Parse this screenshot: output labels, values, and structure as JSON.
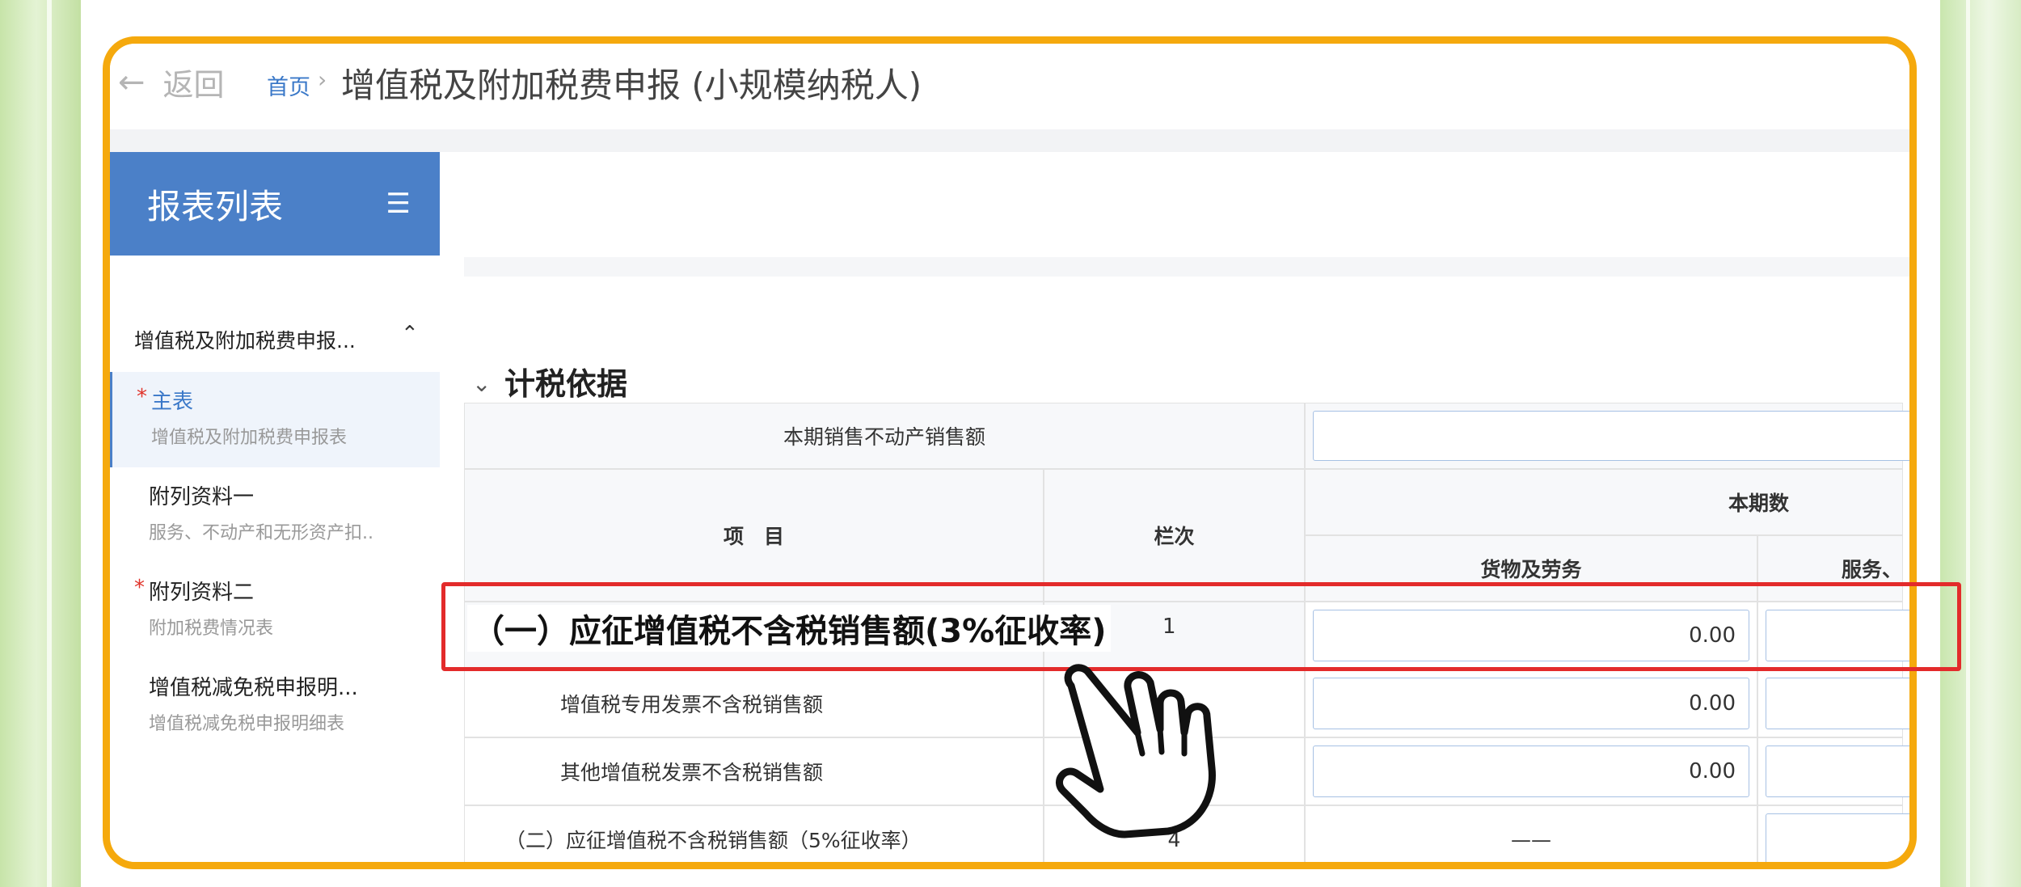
{
  "nav": {
    "back_label": "返回",
    "home_label": "首页",
    "separator": "›",
    "page_title": "增值税及附加税费申报 (小规模纳税人)"
  },
  "sidebar": {
    "header": "报表列表",
    "group_title": "增值税及附加税费申报...",
    "items": [
      {
        "title": "主表",
        "subtitle": "增值税及附加税费申报表",
        "required": "*"
      },
      {
        "title": "附列资料一",
        "subtitle": "服务、不动产和无形资产扣..",
        "required": ""
      },
      {
        "title": "附列资料二",
        "subtitle": "附加税费情况表",
        "required": "*"
      },
      {
        "title": "增值税减免税申报明...",
        "subtitle": "增值税减免税申报明细表",
        "required": ""
      }
    ]
  },
  "section": {
    "title": "计税依据"
  },
  "table": {
    "real_estate_label": "本期销售不动产销售额",
    "col_item": "项　目",
    "col_line": "栏次",
    "col_period": "本期数",
    "col_goods": "货物及劳务",
    "col_services": "服务、",
    "rows": [
      {
        "label": "（一）应征增值税不含税销售额(3%征收率)",
        "line": "1",
        "goods": "0.00"
      },
      {
        "label": "增值税专用发票不含税销售额",
        "line": "",
        "goods": "0.00"
      },
      {
        "label": "其他增值税发票不含税销售额",
        "line": "",
        "goods": "0.00"
      },
      {
        "label": "（二）应征增值税不含税销售额（5%征收率）",
        "line": "4",
        "goods": "——"
      }
    ]
  },
  "icons": {
    "back": "←",
    "menu": "☰",
    "caret_up": "⌃",
    "section_caret": "⌄"
  },
  "colors": {
    "frame": "#f5a90d",
    "highlight": "#e32b2b",
    "sidebar_header": "#4b80c8",
    "link": "#3a78c8"
  }
}
